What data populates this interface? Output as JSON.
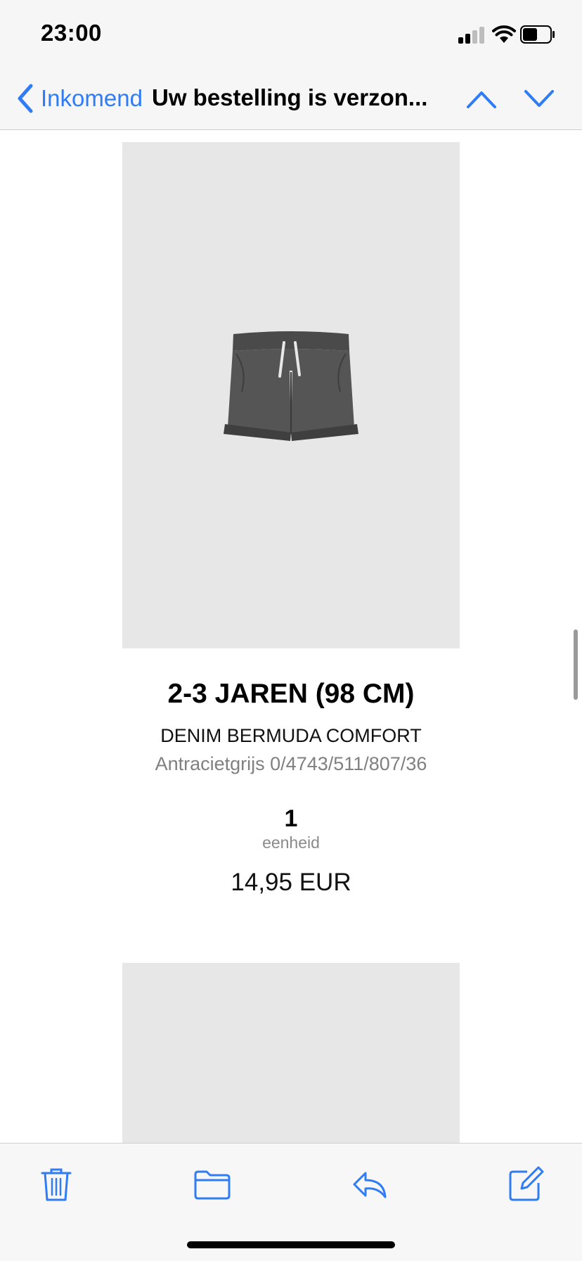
{
  "status_bar": {
    "time": "23:00"
  },
  "nav": {
    "back_label": "Inkomend",
    "title": "Uw bestelling is verzon..."
  },
  "product": {
    "size": "2-3 JAREN (98 CM)",
    "name": "DENIM BERMUDA COMFORT",
    "ref": "Antracietgrijs 0/4743/511/807/36",
    "quantity": "1",
    "quantity_unit": "eenheid",
    "price": "14,95 EUR",
    "image_alt": "denim shorts"
  },
  "colors": {
    "accent": "#2f7cf6",
    "bar_bg": "#f6f6f6",
    "image_bg": "#e7e7e7",
    "secondary_text": "#808080"
  },
  "toolbar": {
    "icons": [
      "trash-icon",
      "folder-icon",
      "reply-icon",
      "compose-icon"
    ]
  }
}
